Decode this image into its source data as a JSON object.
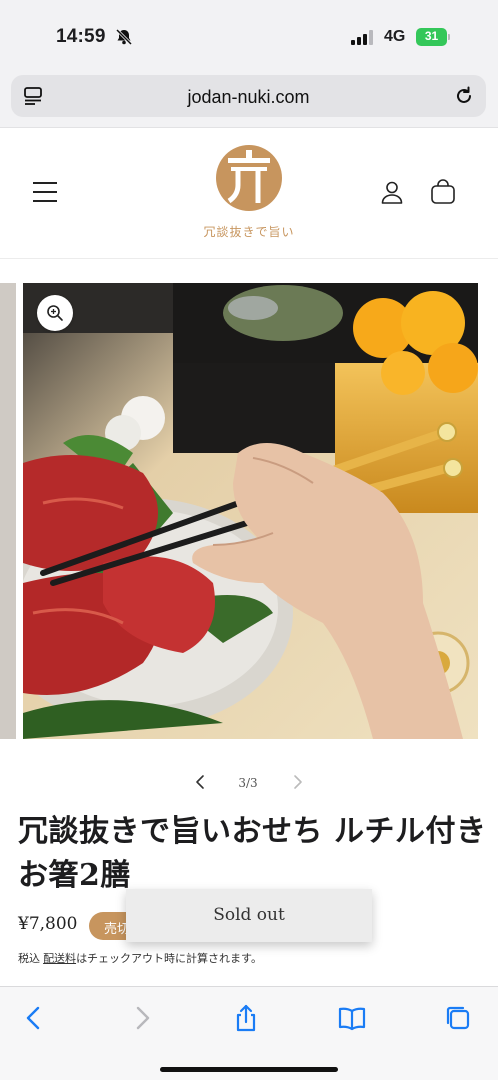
{
  "status_bar": {
    "time": "14:59",
    "network": "4G",
    "battery": "31"
  },
  "browser": {
    "url": "jodan-nuki.com"
  },
  "site": {
    "logo_text": "冗談抜きで旨い"
  },
  "gallery": {
    "counter": "3/3"
  },
  "product": {
    "title": "冗談抜きで旨いおせち ルチル付きお箸2膳",
    "price": "¥7,800",
    "badge": "売切",
    "tax_prefix": "税込",
    "tax_link": "配送料",
    "tax_suffix": "はチェックアウト時に計算されます。"
  },
  "toast": {
    "label": "Sold out"
  },
  "colors": {
    "brand": "#c7955e",
    "battery": "#34c759",
    "ios_blue": "#1a7cf5"
  }
}
